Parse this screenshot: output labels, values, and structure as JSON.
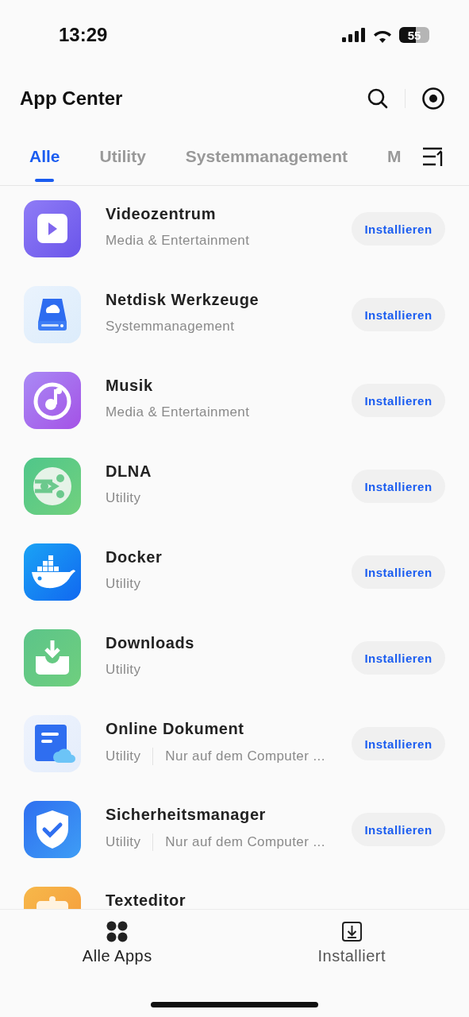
{
  "status_bar": {
    "time": "13:29",
    "battery": "55"
  },
  "header": {
    "title": "App Center"
  },
  "tabs": [
    {
      "label": "Alle",
      "selected": true
    },
    {
      "label": "Utility",
      "selected": false
    },
    {
      "label": "Systemmanagement",
      "selected": false
    },
    {
      "label": "M",
      "selected": false
    }
  ],
  "apps": [
    {
      "name": "Videozentrum",
      "category": "Media & Entertainment",
      "button": "Installieren"
    },
    {
      "name": "Netdisk Werkzeuge",
      "category": "Systemmanagement",
      "button": "Installieren"
    },
    {
      "name": "Musik",
      "category": "Media & Entertainment",
      "button": "Installieren"
    },
    {
      "name": "DLNA",
      "category": "Utility",
      "button": "Installieren"
    },
    {
      "name": "Docker",
      "category": "Utility",
      "button": "Installieren"
    },
    {
      "name": "Downloads",
      "category": "Utility",
      "button": "Installieren"
    },
    {
      "name": "Online Dokument",
      "category": "Utility",
      "note": "Nur auf dem Computer ...",
      "button": "Installieren"
    },
    {
      "name": "Sicherheitsmanager",
      "category": "Utility",
      "note": "Nur auf dem Computer ...",
      "button": "Installieren"
    },
    {
      "name": "Texteditor"
    }
  ],
  "bottom_nav": [
    {
      "label": "Alle Apps",
      "selected": true
    },
    {
      "label": "Installiert",
      "selected": false
    }
  ]
}
